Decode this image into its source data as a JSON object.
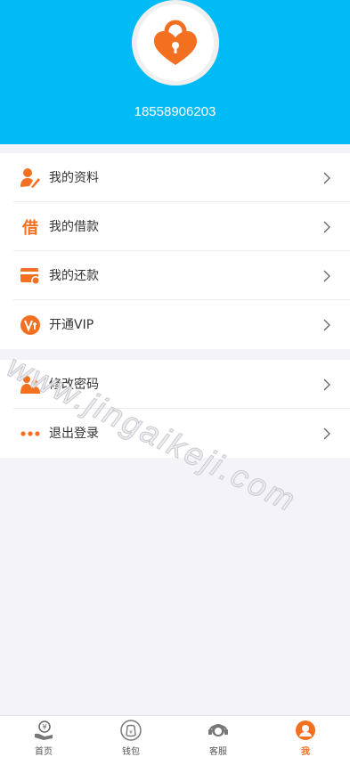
{
  "profile": {
    "phone": "18558906203"
  },
  "menu_group1": [
    {
      "label": "我的资料",
      "icon": "profile-edit-icon"
    },
    {
      "label": "我的借款",
      "icon": "borrow-icon",
      "icon_text": "借"
    },
    {
      "label": "我的还款",
      "icon": "repay-card-icon"
    },
    {
      "label": "开通VIP",
      "icon": "vip-icon"
    }
  ],
  "menu_group2": [
    {
      "label": "修改密码",
      "icon": "users-icon"
    },
    {
      "label": "退出登录",
      "icon": "more-dots-icon"
    }
  ],
  "tabs": [
    {
      "label": "首页",
      "icon": "home-icon"
    },
    {
      "label": "钱包",
      "icon": "wallet-icon"
    },
    {
      "label": "客服",
      "icon": "service-icon"
    },
    {
      "label": "我",
      "icon": "me-icon",
      "active": true
    }
  ],
  "watermark": "www.jingaikeji.com",
  "colors": {
    "header_bg": "#00bbf6",
    "accent": "#f37021",
    "page_bg": "#f4f4f8"
  }
}
